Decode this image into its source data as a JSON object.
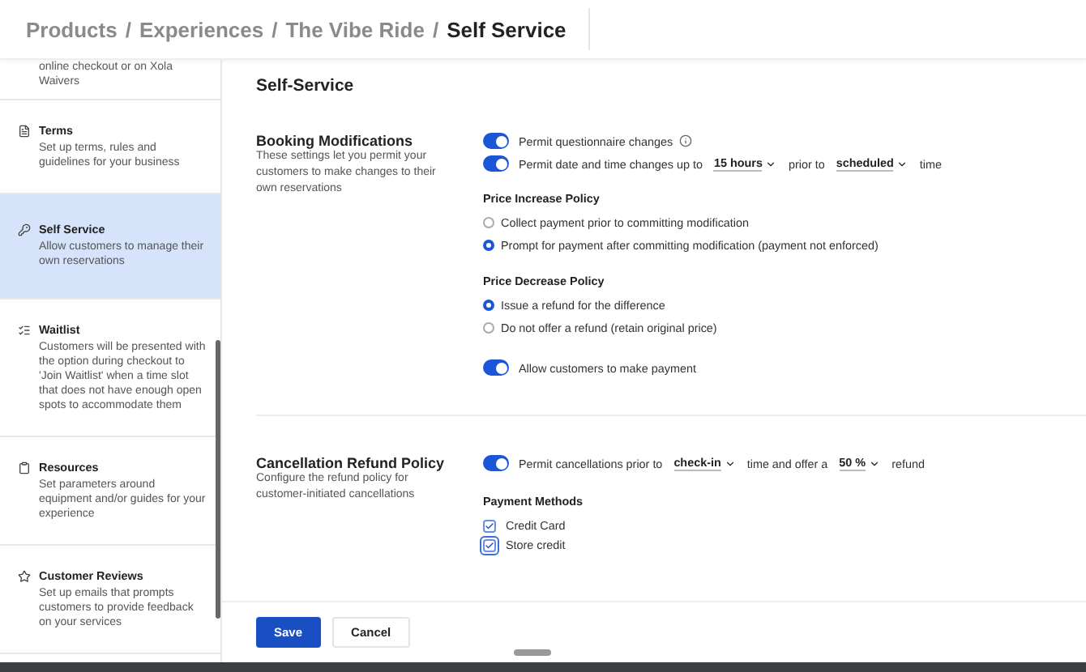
{
  "breadcrumb_separator": "/",
  "breadcrumb": [
    {
      "label": "Products",
      "current": false
    },
    {
      "label": "Experiences",
      "current": false
    },
    {
      "label": "The Vibe Ride",
      "current": false
    },
    {
      "label": "Self Service",
      "current": true
    }
  ],
  "sidebar": {
    "items": [
      {
        "kind": "fragment",
        "description": "online checkout or on Xola Waivers",
        "selected": false
      },
      {
        "kind": "terms",
        "title": "Terms",
        "description": "Set up terms, rules and guidelines for your business",
        "selected": false
      },
      {
        "kind": "self-service",
        "title": "Self Service",
        "description": "Allow customers to manage their own reservations",
        "selected": true
      },
      {
        "kind": "waitlist",
        "title": "Waitlist",
        "description": "Customers will be presented with the option during checkout to 'Join Waitlist' when a time slot that does not have enough open spots to accommodate them",
        "selected": false
      },
      {
        "kind": "resources",
        "title": "Resources",
        "description": "Set parameters around equipment and/or guides for your experience",
        "selected": false
      },
      {
        "kind": "reviews",
        "title": "Customer Reviews",
        "description": "Set up emails that prompts customers to provide feedback on your services",
        "selected": false
      }
    ]
  },
  "page_title": "Self-Service",
  "sections": [
    {
      "title": "Booking Modifications",
      "description": "These settings let you permit your customers to make changes to their own reservations",
      "settings": [
        {
          "kind": "toggle",
          "on": true,
          "info": true,
          "parts": [
            {
              "kind": "text",
              "text": "Permit questionnaire changes"
            }
          ]
        },
        {
          "kind": "toggle",
          "on": true,
          "info": false,
          "parts": [
            {
              "kind": "text",
              "text": "Permit date and time changes up to"
            },
            {
              "kind": "dropdown",
              "text": "15 hours"
            },
            {
              "kind": "text",
              "text": "prior to"
            },
            {
              "kind": "dropdown",
              "text": "scheduled"
            },
            {
              "kind": "text",
              "text": "time"
            }
          ]
        },
        {
          "kind": "radio",
          "heading": "Price Increase Policy",
          "options": [
            {
              "label": "Collect payment prior to committing modification",
              "selected": false
            },
            {
              "label": "Prompt for payment after committing modification (payment not enforced)",
              "selected": true
            }
          ]
        },
        {
          "kind": "radio",
          "heading": "Price Decrease Policy",
          "options": [
            {
              "label": "Issue a refund for the difference",
              "selected": true
            },
            {
              "label": "Do not offer a refund (retain original price)",
              "selected": false
            }
          ]
        },
        {
          "kind": "toggle",
          "on": true,
          "info": false,
          "parts": [
            {
              "kind": "text",
              "text": "Allow customers to make payment"
            }
          ]
        }
      ]
    },
    {
      "title": "Cancellation Refund Policy",
      "description": "Configure the refund policy for customer-initiated cancellations",
      "settings": [
        {
          "kind": "toggle",
          "on": true,
          "info": false,
          "parts": [
            {
              "kind": "text",
              "text": "Permit cancellations prior to"
            },
            {
              "kind": "dropdown",
              "text": "check-in"
            },
            {
              "kind": "text",
              "text": "time and offer a"
            },
            {
              "kind": "dropdown",
              "text": "50 %"
            },
            {
              "kind": "text",
              "text": "refund"
            }
          ]
        },
        {
          "kind": "checkbox",
          "heading": "Payment Methods",
          "options": [
            {
              "label": "Credit Card",
              "checked": true,
              "focused": false
            },
            {
              "label": "Store credit",
              "checked": true,
              "focused": true
            }
          ]
        }
      ]
    }
  ],
  "buttons": [
    {
      "kind": "primary",
      "label": "Save"
    },
    {
      "kind": "secondary",
      "label": "Cancel"
    }
  ]
}
